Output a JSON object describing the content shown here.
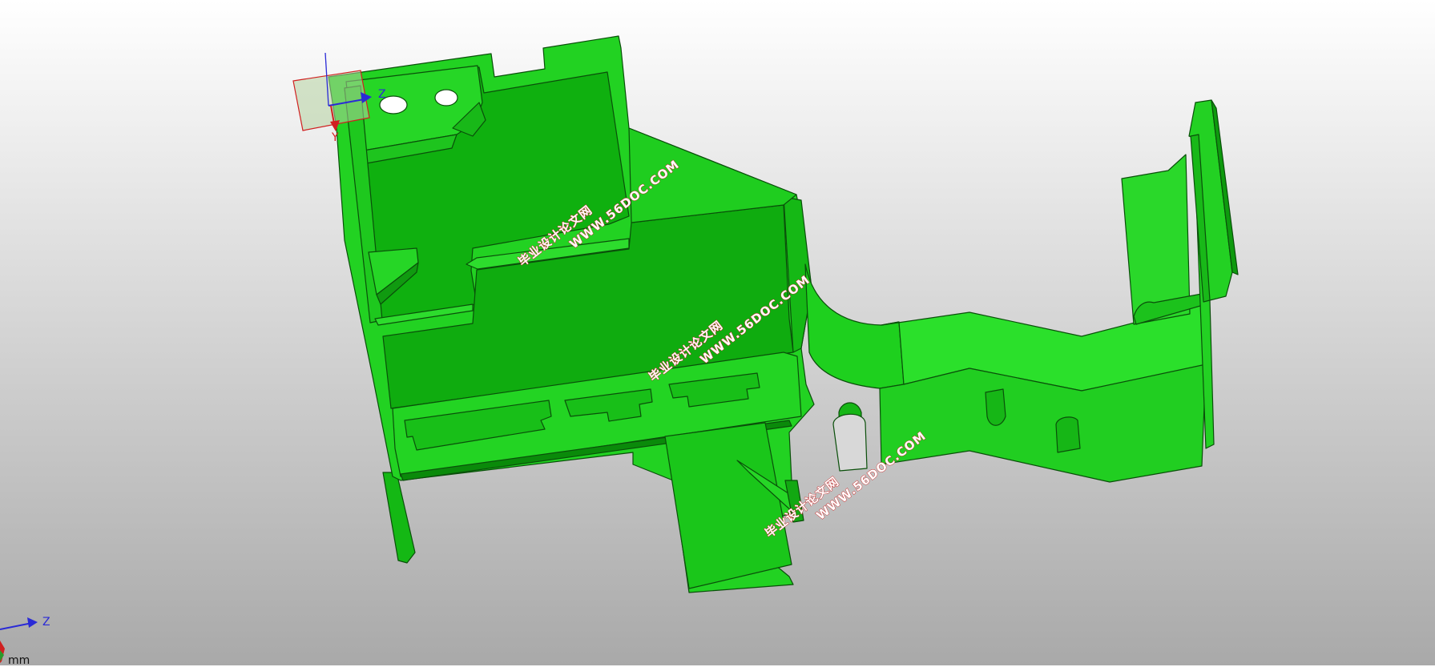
{
  "viewport": {
    "background_top": "#ffffff",
    "background_bottom": "#a9a9a9",
    "model_color": "#1fd31f",
    "model_dark": "#0da90d",
    "edge_color": "#0a4f0a"
  },
  "watermarks": [
    {
      "line1": "毕业设计论文网",
      "line2": "WWW.56DOC.COM"
    },
    {
      "line1": "毕业设计论文网",
      "line2": "WWW.56DOC.COM"
    },
    {
      "line1": "毕业设计论文网",
      "line2": "WWW.56DOC.COM"
    }
  ],
  "origin_triad": {
    "z_label": "Z",
    "y_label": "Y"
  },
  "corner_triad": {
    "z_label": "Z"
  },
  "units": "mm"
}
